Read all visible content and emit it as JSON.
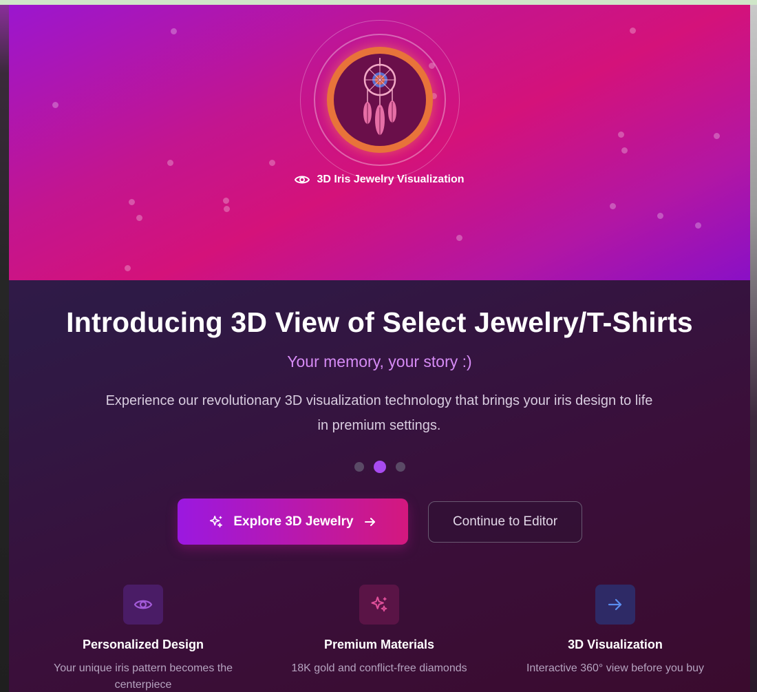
{
  "hero": {
    "caption": "3D Iris Jewelry Visualization",
    "caption_icon": "eye-icon",
    "logo_icon": "dreamcatcher-icon"
  },
  "title": "Introducing 3D View of Select Jewelry/T-Shirts",
  "subtitle": "Your memory, your story :)",
  "description": "Experience our revolutionary 3D visualization technology that brings your iris design to life in premium settings.",
  "pager": {
    "count": 3,
    "active_index": 1
  },
  "buttons": {
    "primary_label": "Explore 3D Jewelry",
    "primary_icon_left": "sparkles-icon",
    "primary_icon_right": "arrow-right-icon",
    "secondary_label": "Continue to Editor"
  },
  "features": [
    {
      "icon": "eye-icon",
      "title": "Personalized Design",
      "desc": "Your unique iris pattern becomes the centerpiece",
      "color": "#a35bd9"
    },
    {
      "icon": "sparkles-icon",
      "title": "Premium Materials",
      "desc": "18K gold and conflict-free diamonds",
      "color": "#e0509a"
    },
    {
      "icon": "arrow-right-icon",
      "title": "3D Visualization",
      "desc": "Interactive 360° view before you buy",
      "color": "#5a8ef0"
    }
  ],
  "colors": {
    "hero_start": "#9b16cf",
    "hero_mid": "#d4127a",
    "accent_purple": "#a84bf0",
    "subtitle": "#d68bf5",
    "logo_ring": "#e8733a"
  }
}
